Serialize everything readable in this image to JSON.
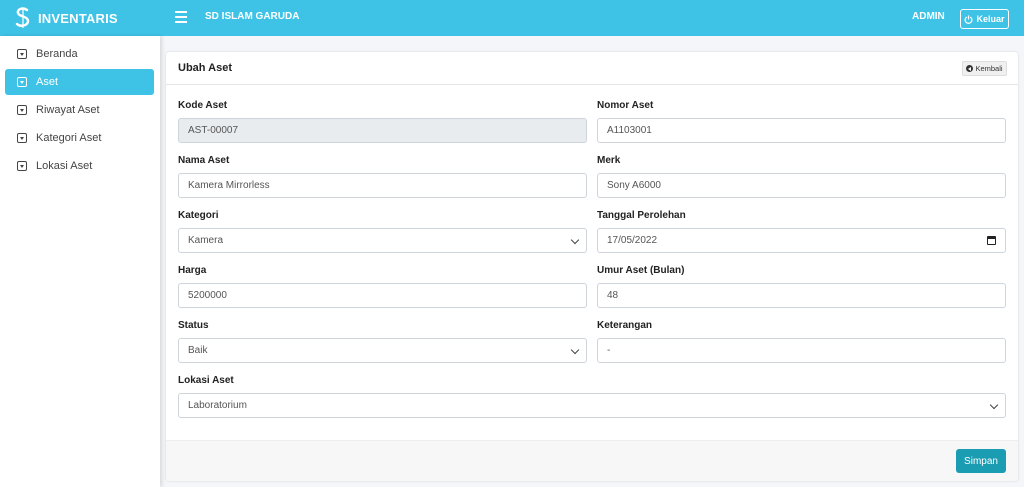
{
  "app": {
    "brand": "INVENTARIS",
    "school": "SD ISLAM GARUDA",
    "user": "ADMIN",
    "logout_label": "Keluar"
  },
  "sidebar": {
    "items": [
      {
        "label": "Beranda",
        "active": false
      },
      {
        "label": "Aset",
        "active": true
      },
      {
        "label": "Riwayat Aset",
        "active": false
      },
      {
        "label": "Kategori Aset",
        "active": false
      },
      {
        "label": "Lokasi Aset",
        "active": false
      }
    ]
  },
  "form": {
    "title": "Ubah Aset",
    "back_label": "Kembali",
    "fields": {
      "kode_aset": {
        "label": "Kode Aset",
        "value": "AST-00007"
      },
      "nomor_aset": {
        "label": "Nomor Aset",
        "value": "A1103001"
      },
      "nama_aset": {
        "label": "Nama Aset",
        "value": "Kamera Mirrorless"
      },
      "merk": {
        "label": "Merk",
        "value": "Sony A6000"
      },
      "kategori": {
        "label": "Kategori",
        "value": "Kamera"
      },
      "tanggal_perolehan": {
        "label": "Tanggal Perolehan",
        "value": "17/05/2022"
      },
      "harga": {
        "label": "Harga",
        "value": "5200000"
      },
      "umur_aset": {
        "label": "Umur Aset (Bulan)",
        "value": "48"
      },
      "status": {
        "label": "Status",
        "value": "Baik"
      },
      "keterangan": {
        "label": "Keterangan",
        "value": "-"
      },
      "lokasi_aset": {
        "label": "Lokasi Aset",
        "value": "Laboratorium"
      }
    },
    "save_label": "Simpan"
  },
  "colors": {
    "header": "#3ec3e6",
    "active_nav": "#3ec3e6",
    "save_button": "#1a9db3"
  }
}
